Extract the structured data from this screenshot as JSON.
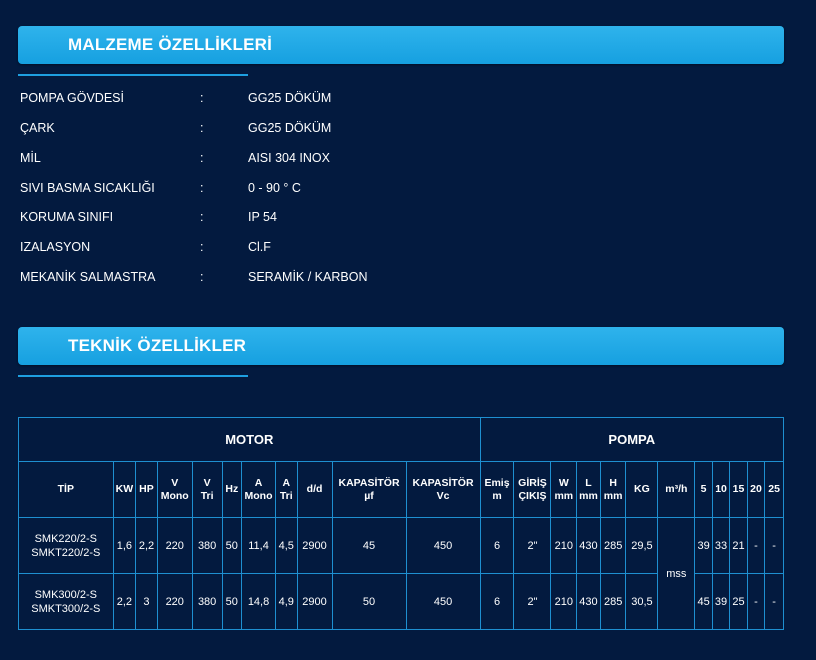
{
  "material": {
    "title": "MALZEME ÖZELLİKLERİ",
    "rows": [
      {
        "key": "POMPA GÖVDESİ",
        "sep": ":",
        "value": "GG25 DÖKÜM"
      },
      {
        "key": "ÇARK",
        "sep": ":",
        "value": "GG25 DÖKÜM"
      },
      {
        "key": "MİL",
        "sep": ":",
        "value": "AISI 304 INOX"
      },
      {
        "key": "SIVI BASMA SICAKLIĞI",
        "sep": ":",
        "value": "0 - 90 ° C"
      },
      {
        "key": "KORUMA SINIFI",
        "sep": ":",
        "value": "IP 54"
      },
      {
        "key": "IZALASYON",
        "sep": ":",
        "value": "Cl.F"
      },
      {
        "key": "MEKANİK SALMASTRA",
        "sep": ":",
        "value": "SERAMİK / KARBON"
      }
    ]
  },
  "technical": {
    "title": "TEKNİK ÖZELLİKLER",
    "groups": {
      "motor": "MOTOR",
      "pump": "POMPA"
    },
    "headers": {
      "tip": "TİP",
      "kw": "KW",
      "hp": "HP",
      "v_mono": [
        "V",
        "Mono"
      ],
      "v_tri": [
        "V",
        "Tri"
      ],
      "hz": "Hz",
      "a_mono": [
        "A",
        "Mono"
      ],
      "a_tri": [
        "A",
        "Tri"
      ],
      "dd": "d/d",
      "cap_uf": [
        "KAPASİTÖR",
        "µf"
      ],
      "cap_vc": [
        "KAPASİTÖR",
        "Vc"
      ],
      "suction": [
        "Emiş",
        "m"
      ],
      "inout": [
        "GİRİŞ",
        "ÇIKIŞ"
      ],
      "w": [
        "W",
        "mm"
      ],
      "l": [
        "L",
        "mm"
      ],
      "h": [
        "H",
        "mm"
      ],
      "kg": "KG",
      "m3h": "m³/h",
      "f5": "5",
      "f10": "10",
      "f15": "15",
      "f20": "20",
      "f25": "25"
    },
    "mss": "mss",
    "rows": [
      {
        "tip": [
          "SMK220/2-S",
          "SMKT220/2-S"
        ],
        "kw": "1,6",
        "hp": "2,2",
        "v_mono": "220",
        "v_tri": "380",
        "hz": "50",
        "a_mono": "11,4",
        "a_tri": "4,5",
        "dd": "2900",
        "cap_uf": "45",
        "cap_vc": "450",
        "suction": "6",
        "inout": "2\"",
        "w": "210",
        "l": "430",
        "h": "285",
        "kg": "29,5",
        "f5": "39",
        "f10": "33",
        "f15": "21",
        "f20": "-",
        "f25": "-"
      },
      {
        "tip": [
          "SMK300/2-S",
          "SMKT300/2-S"
        ],
        "kw": "2,2",
        "hp": "3",
        "v_mono": "220",
        "v_tri": "380",
        "hz": "50",
        "a_mono": "14,8",
        "a_tri": "4,9",
        "dd": "2900",
        "cap_uf": "50",
        "cap_vc": "450",
        "suction": "6",
        "inout": "2\"",
        "w": "210",
        "l": "430",
        "h": "285",
        "kg": "30,5",
        "f5": "45",
        "f10": "39",
        "f15": "25",
        "f20": "-",
        "f25": "-"
      }
    ]
  }
}
